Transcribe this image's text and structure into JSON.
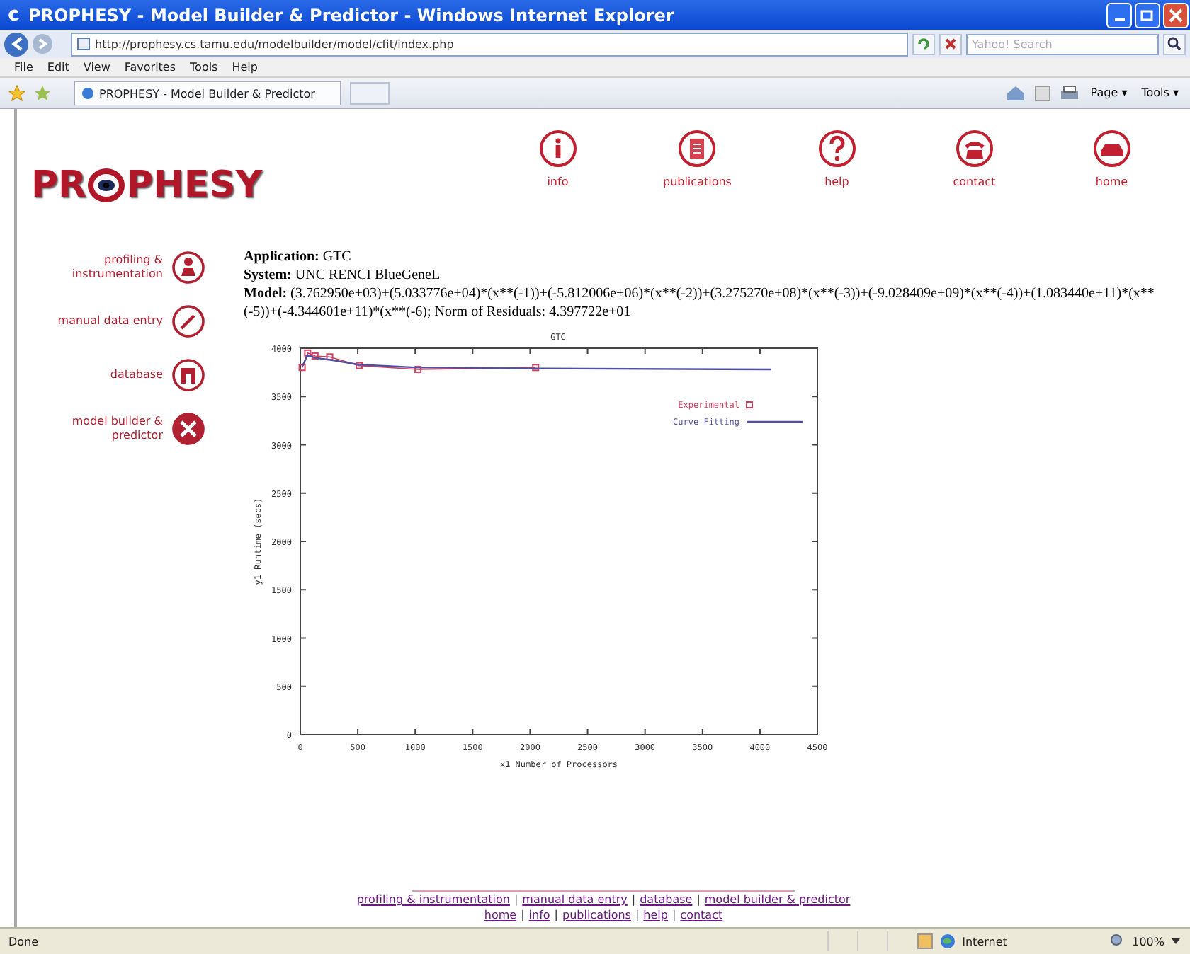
{
  "window": {
    "title": "PROPHESY - Model Builder & Predictor - Windows Internet Explorer"
  },
  "address_bar": {
    "url": "http://prophesy.cs.tamu.edu/modelbuilder/model/cfit/index.php",
    "search_placeholder": "Yahoo! Search"
  },
  "menu": [
    "File",
    "Edit",
    "View",
    "Favorites",
    "Tools",
    "Help"
  ],
  "tab": {
    "label": "PROPHESY - Model Builder & Predictor",
    "selected": true
  },
  "toolbar": [
    "Page ▾",
    "Tools ▾"
  ],
  "logo": {
    "left": "PR",
    "right": "PHESY"
  },
  "top_nav": [
    {
      "label": "info",
      "kind": "info"
    },
    {
      "label": "publications",
      "kind": "publications"
    },
    {
      "label": "help",
      "kind": "help"
    },
    {
      "label": "contact",
      "kind": "contact"
    },
    {
      "label": "home",
      "kind": "home"
    }
  ],
  "side_nav": [
    {
      "label": "profiling & instrumentation",
      "kind": "profiling"
    },
    {
      "label": "manual data entry",
      "kind": "entry"
    },
    {
      "label": "database",
      "kind": "database"
    },
    {
      "label": "model builder & predictor",
      "kind": "builder"
    }
  ],
  "details": [
    {
      "label": "Application:",
      "value": "GTC"
    },
    {
      "label": "System:",
      "value": "UNC RENCI BlueGeneL"
    },
    {
      "label": "Model:",
      "value": "(3.762950e+03)+(5.033776e+04)*(x**(-1))+(-5.812006e+06)*(x**(-2))+(3.275270e+08)*(x**(-3))+(-9.028409e+09)*(x**(-4))+(1.083440e+11)*(x**(-5))+(-4.344601e+11)*(x**(-6); Norm of Residuals: 4.397722e+01"
    }
  ],
  "chart_data": {
    "type": "line",
    "title": "GTC",
    "xlabel": "x1 Number of Processors",
    "ylabel": "y1 Runtime (secs)",
    "x": [
      16,
      64,
      128,
      256,
      512,
      1024,
      2048,
      4096
    ],
    "series": [
      {
        "name": "Experimental",
        "color": "#d04060",
        "marker": "square",
        "values": [
          3800,
          3950,
          3920,
          3910,
          3820,
          3780,
          3800,
          null
        ]
      },
      {
        "name": "Curve Fitting",
        "color": "#5050a0",
        "values": [
          3810,
          3930,
          3900,
          3880,
          3830,
          3800,
          3790,
          3780
        ]
      }
    ],
    "xlim": [
      0,
      4500
    ],
    "ylim": [
      0,
      4000
    ],
    "xticks": [
      0,
      500,
      1000,
      1500,
      2000,
      2500,
      3000,
      3500,
      4000,
      4500
    ],
    "yticks": [
      0,
      500,
      1000,
      1500,
      2000,
      2500,
      3000,
      3500,
      4000
    ]
  },
  "footer": {
    "separator": "|",
    "line_1": [
      "profiling & instrumentation",
      "manual data entry",
      "database",
      "model builder & predictor"
    ],
    "line_2": [
      "home",
      "info",
      "publications",
      "help",
      "contact"
    ]
  },
  "status_bar": {
    "text": "Done",
    "zone": "Internet",
    "zoom": "100%"
  }
}
